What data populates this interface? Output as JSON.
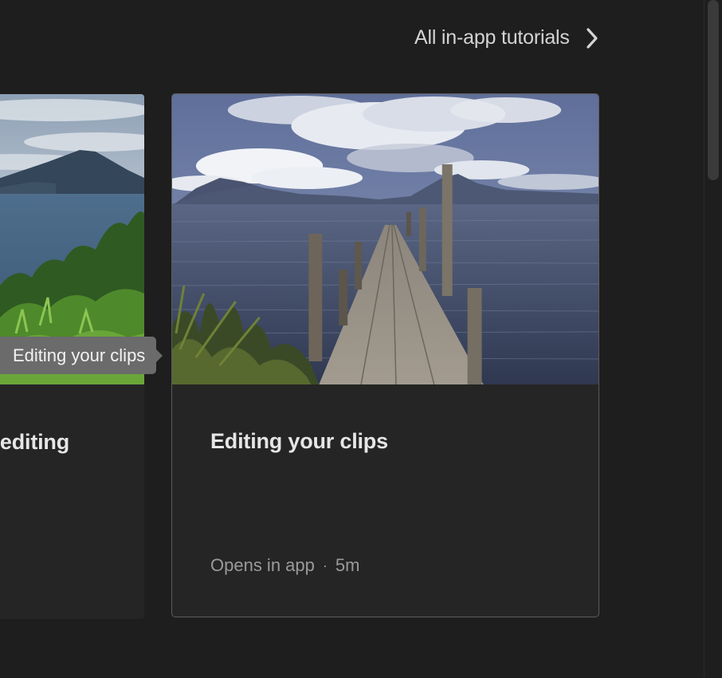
{
  "header": {
    "all_tutorials_label": "All in-app tutorials"
  },
  "cards": [
    {
      "title": "editing",
      "image": "lake-volcano-with-foliage"
    },
    {
      "title": "Editing your clips",
      "meta_opens": "Opens in app",
      "meta_sep": "·",
      "meta_duration": "5m",
      "image": "wooden-pier-on-lake"
    }
  ],
  "tooltip": {
    "text": "Editing your clips"
  },
  "colors": {
    "background": "#1e1e1e",
    "card": "#252525",
    "card_border_selected": "#5c5c5c",
    "tooltip_bg": "#6b6b6b",
    "title_text": "#e6e6e6",
    "meta_text": "#9a9a9a"
  }
}
